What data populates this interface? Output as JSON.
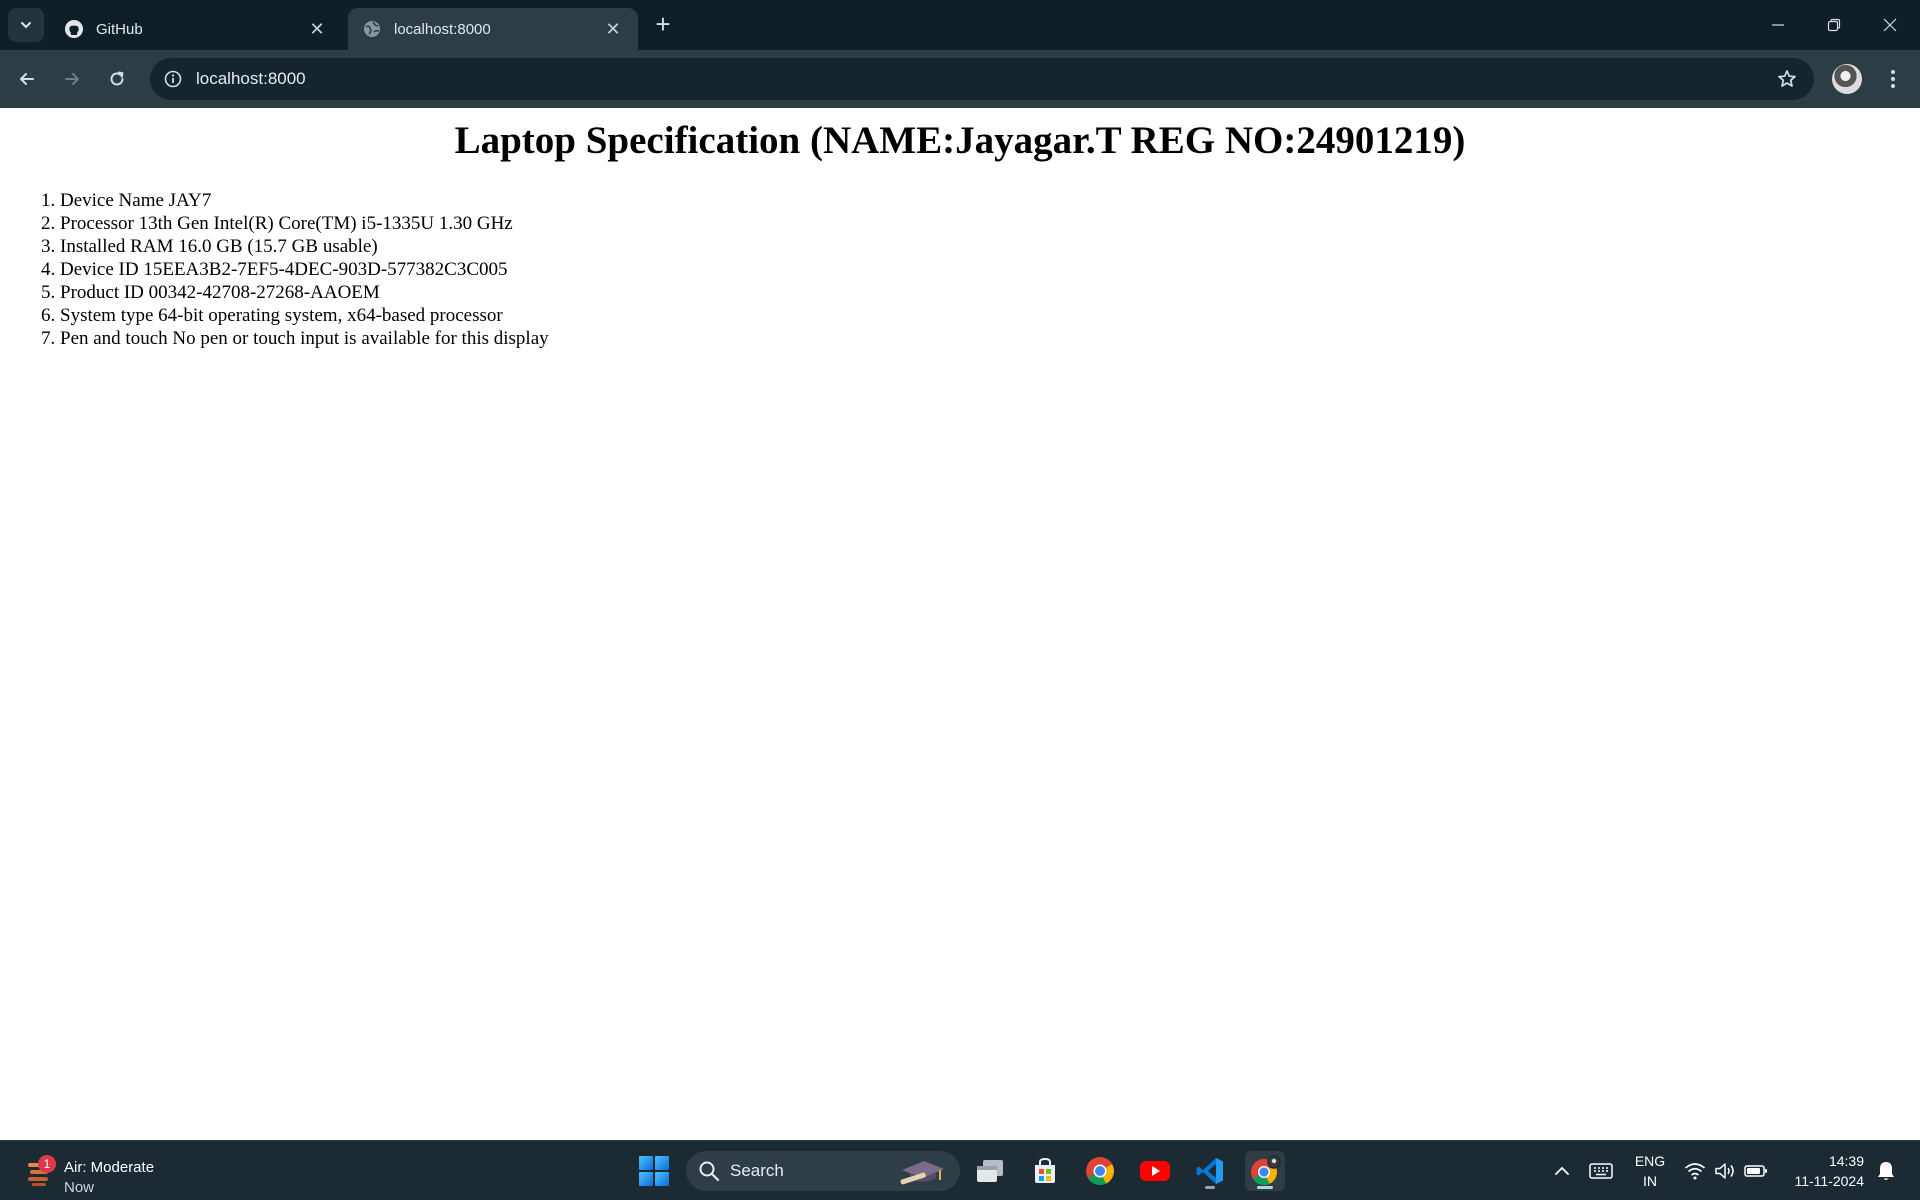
{
  "browser": {
    "tabs": [
      {
        "title": "GitHub",
        "favicon": "github-icon",
        "active": false
      },
      {
        "title": "localhost:8000",
        "favicon": "globe-icon",
        "active": true
      }
    ],
    "address": "localhost:8000"
  },
  "page": {
    "heading": "Laptop Specification (NAME:Jayagar.T REG NO:24901219)",
    "specs": [
      "Device Name JAY7",
      "Processor 13th Gen Intel(R) Core(TM) i5-1335U 1.30 GHz",
      "Installed RAM 16.0 GB (15.7 GB usable)",
      "Device ID 15EEA3B2-7EF5-4DEC-903D-577382C3C005",
      "Product ID 00342-42708-27268-AAOEM",
      "System type 64-bit operating system, x64-based processor",
      "Pen and touch No pen or touch input is available for this display"
    ]
  },
  "taskbar": {
    "weather": {
      "badge": "1",
      "title": "Air: Moderate",
      "subtitle": "Now"
    },
    "search_label": "Search",
    "apps": [
      "file-explorer-icon",
      "microsoft-store-icon",
      "chrome-icon",
      "youtube-icon",
      "vscode-icon",
      "chrome-profile-icon"
    ],
    "language": {
      "line1": "ENG",
      "line2": "IN"
    },
    "clock": {
      "time": "14:39",
      "date": "11-11-2024"
    }
  },
  "colors": {
    "titlebar": "#0f1f27",
    "toolbar": "#2c3d45",
    "taskbar": "#1b2a33",
    "accent": "#b7d4e6"
  }
}
